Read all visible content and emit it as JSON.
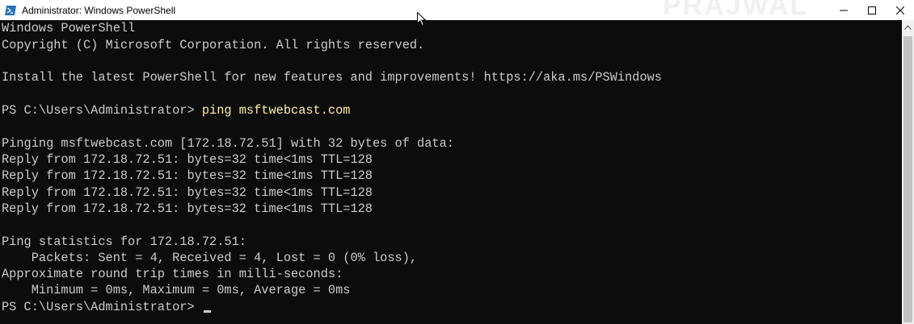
{
  "window": {
    "title": "Administrator: Windows PowerShell",
    "icon": "powershell-icon",
    "controls": [
      "minimize-icon",
      "maximize-icon",
      "close-icon"
    ]
  },
  "console": {
    "line_01": "Windows PowerShell",
    "line_02": "Copyright (C) Microsoft Corporation. All rights reserved.",
    "line_04": "Install the latest PowerShell for new features and improvements! https://aka.ms/PSWindows",
    "prompt_1": "PS C:\\Users\\Administrator> ",
    "command_1": "ping msftwebcast.com",
    "line_08": "Pinging msftwebcast.com [172.18.72.51] with 32 bytes of data:",
    "line_09": "Reply from 172.18.72.51: bytes=32 time<1ms TTL=128",
    "line_10": "Reply from 172.18.72.51: bytes=32 time<1ms TTL=128",
    "line_11": "Reply from 172.18.72.51: bytes=32 time<1ms TTL=128",
    "line_12": "Reply from 172.18.72.51: bytes=32 time<1ms TTL=128",
    "line_14": "Ping statistics for 172.18.72.51:",
    "line_15": "    Packets: Sent = 4, Received = 4, Lost = 0 (0% loss),",
    "line_16": "Approximate round trip times in milli-seconds:",
    "line_17": "    Minimum = 0ms, Maximum = 0ms, Average = 0ms",
    "prompt_2": "PS C:\\Users\\Administrator> "
  },
  "colors": {
    "background": "#0c0c0c",
    "foreground": "#cccccc",
    "command": "#f9f1a5",
    "titlebar": "#ffffff"
  }
}
